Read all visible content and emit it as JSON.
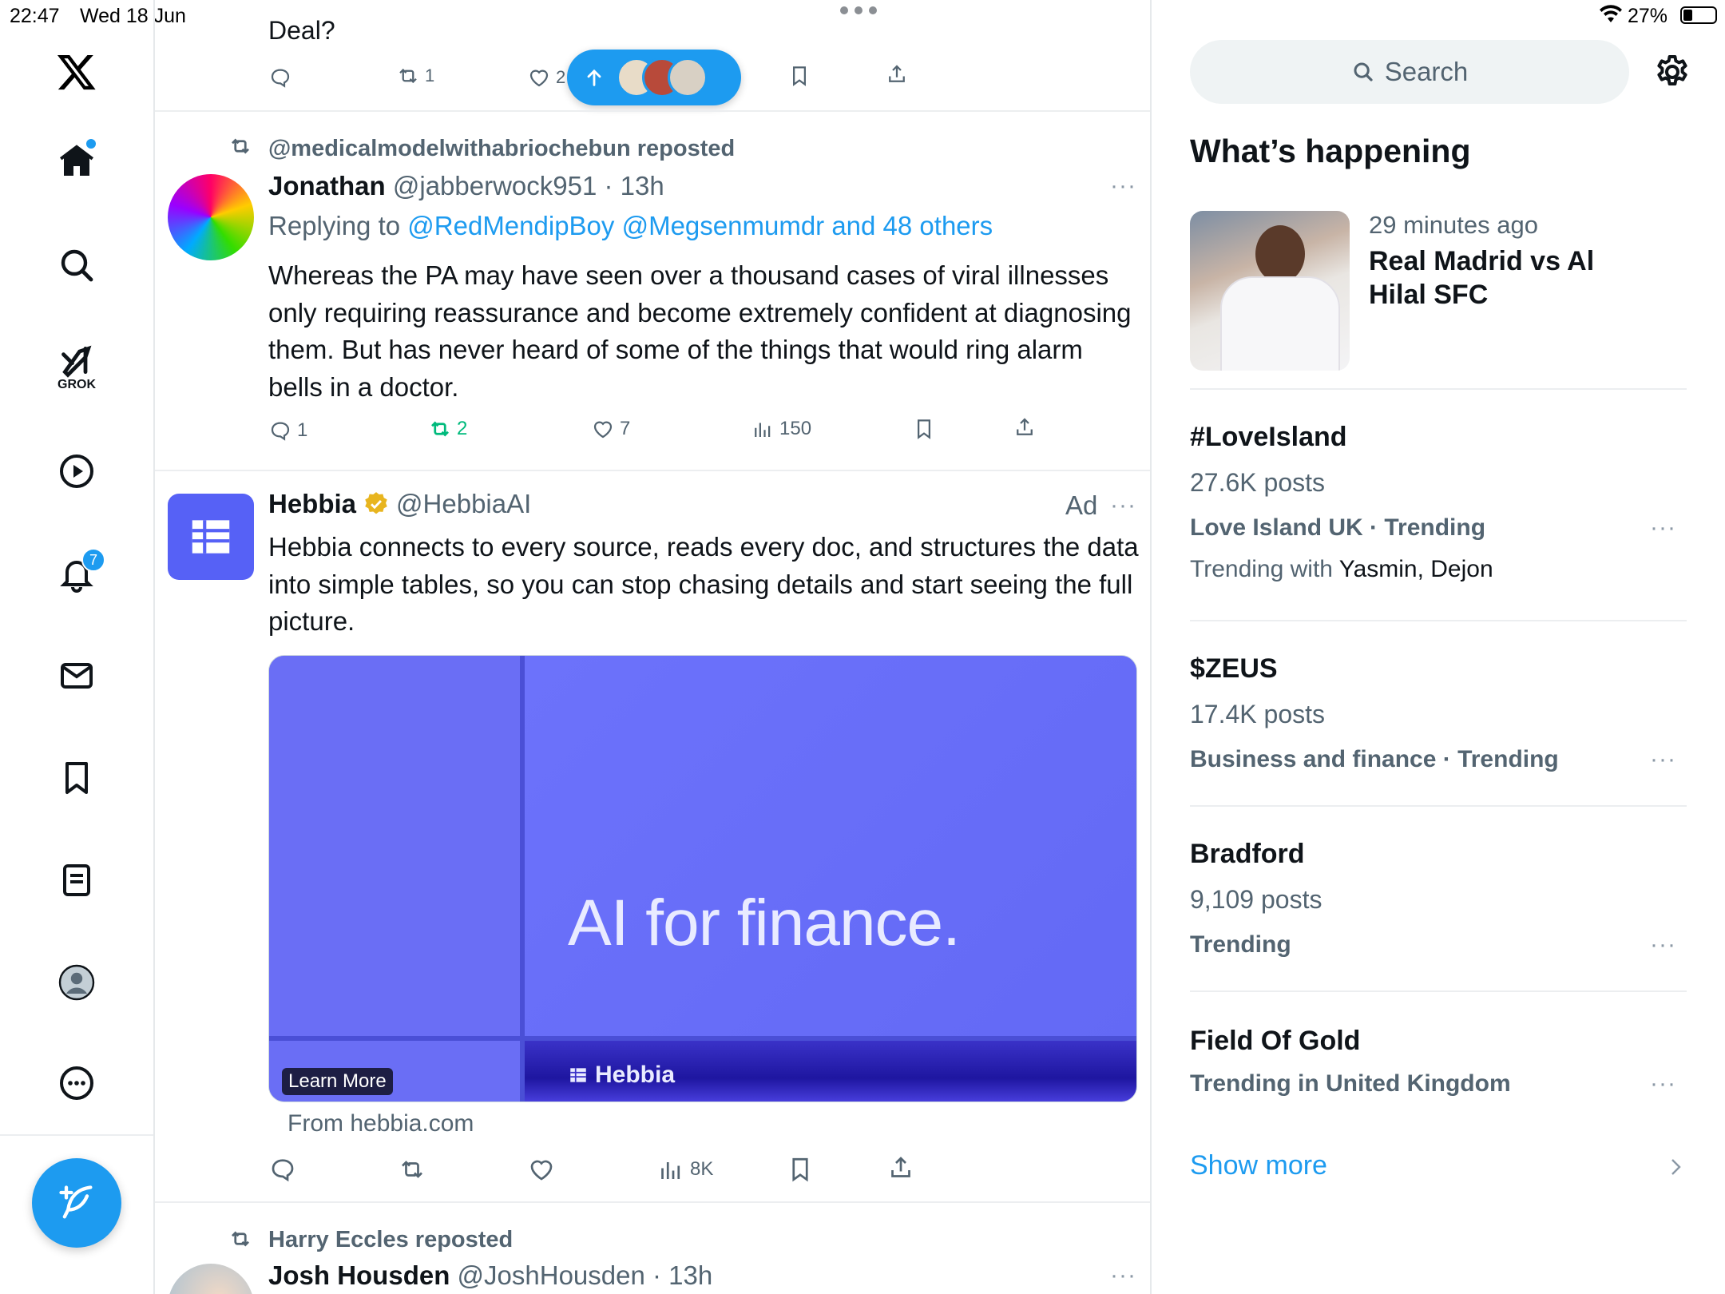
{
  "status_bar": {
    "time": "22:47",
    "date": "Wed 18 Jun",
    "battery": "27%"
  },
  "nav": {
    "grok_label": "GROK",
    "notifications_badge": "7"
  },
  "feed": {
    "prev_post": {
      "text": "Deal?",
      "retweets": "1",
      "likes": "2"
    },
    "jump_pill": {
      "icon": "arrow-up-icon"
    },
    "post1": {
      "repost_label": "@medicalmodelwithabriochebun reposted",
      "name": "Jonathan",
      "handle": "@jabberwock951",
      "time": "13h",
      "replying_prefix": "Replying to",
      "replying_to": "@RedMendipBoy @Megsenmumdr and 48 others",
      "body": "Whereas the PA may have seen over a thousand cases of viral illnesses only requiring reassurance and become extremely confident at diagnosing them. But has never heard of some of the things that would ring alarm bells in a doctor.",
      "replies": "1",
      "retweets": "2",
      "likes": "7",
      "views": "150"
    },
    "ad": {
      "name": "Hebbia",
      "handle": "@HebbiaAI",
      "ad_label": "Ad",
      "body": "Hebbia connects to every source, reads every doc, and structures the data into simple tables, so you can stop chasing details and start seeing the full picture.",
      "image_headline": "AI for finance.",
      "image_brand": "Hebbia",
      "learn_more": "Learn More",
      "from": "From hebbia.com",
      "views": "8K"
    },
    "post2": {
      "repost_label": "Harry Eccles reposted",
      "name": "Josh Housden",
      "handle": "@JoshHousden",
      "time": "13h"
    }
  },
  "sidebar": {
    "search_placeholder": "Search",
    "heading": "What’s happening",
    "featured": {
      "time": "29 minutes ago",
      "title": "Real Madrid vs Al Hilal SFC"
    },
    "trends": [
      {
        "title": "#LoveIsland",
        "posts": "27.6K posts",
        "meta": "Love Island UK · Trending",
        "extra_prefix": "Trending with ",
        "extra_names": "Yasmin, Dejon"
      },
      {
        "title": "$ZEUS",
        "posts": "17.4K posts",
        "meta": "Business and finance · Trending"
      },
      {
        "title": "Bradford",
        "posts": "9,109 posts",
        "meta": "Trending"
      },
      {
        "title": "Field Of Gold",
        "meta": "Trending in United Kingdom"
      }
    ],
    "show_more": "Show more"
  },
  "colors": {
    "accent": "#1d9bf0",
    "retweet_green": "#00ba7c",
    "ad_purple": "#6267f7"
  }
}
